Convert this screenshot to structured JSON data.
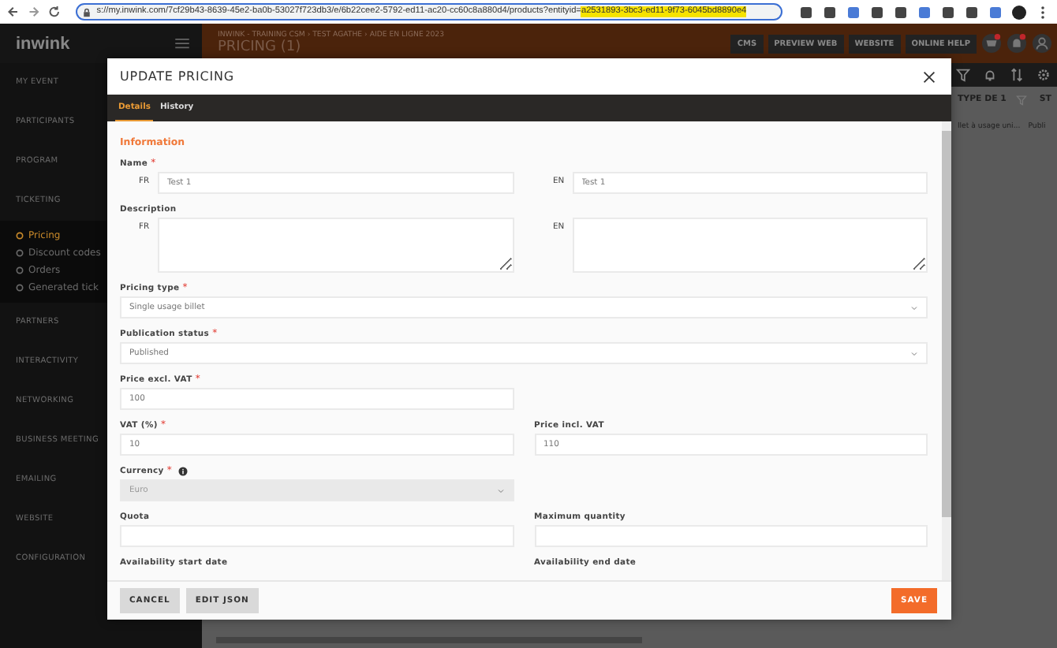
{
  "browser": {
    "url": "s://my.inwink.com/7cf29b43-8639-45e2-ba0b-53027f723db3/e/6b22cee2-5792-ed11-ac20-cc60c8a880d4/products?entityid=",
    "url_highlight": "a2531893-3bc3-ed11-9f73-6045bd8890e4"
  },
  "app": {
    "logo": "inwink",
    "breadcrumb": "INWINK - TRAINING CSM › TEST AGATHE › AIDE EN LIGNE 2023",
    "page_title": "PRICING (1)",
    "header_buttons": [
      "CMS",
      "PREVIEW WEB",
      "WEBSITE",
      "ONLINE HELP"
    ]
  },
  "sidebar": {
    "items": [
      {
        "label": "MY EVENT"
      },
      {
        "label": "PARTICIPANTS"
      },
      {
        "label": "PROGRAM"
      },
      {
        "label": "TICKETING",
        "children": [
          {
            "label": "Pricing",
            "selected": true
          },
          {
            "label": "Discount codes",
            "selected": false
          },
          {
            "label": "Orders",
            "selected": false
          },
          {
            "label": "Generated tick",
            "selected": false
          }
        ]
      },
      {
        "label": "PARTNERS"
      },
      {
        "label": "INTERACTIVITY"
      },
      {
        "label": "NETWORKING"
      },
      {
        "label": "BUSINESS MEETING"
      },
      {
        "label": "EMAILING"
      },
      {
        "label": "WEBSITE"
      },
      {
        "label": "CONFIGURATION"
      }
    ]
  },
  "table": {
    "columns": [
      "TYPE DE 1",
      "ST"
    ],
    "rows": [
      [
        "llet à usage uni...",
        "Publi"
      ]
    ]
  },
  "modal": {
    "title": "UPDATE PRICING",
    "tabs": [
      {
        "label": "Details",
        "selected": true
      },
      {
        "label": "History",
        "selected": false
      }
    ],
    "section_title": "Information",
    "rows": [
      {
        "fields": [
          {
            "label": "Name",
            "required_mark": "*",
            "kind": "translated",
            "langs": [
              {
                "code": "FR",
                "value": "Test 1"
              },
              {
                "code": "EN",
                "value": "Test 1"
              }
            ]
          }
        ]
      },
      {
        "fields": [
          {
            "label": "Description",
            "kind": "translated-area",
            "langs": [
              {
                "code": "FR"
              },
              {
                "code": "EN"
              }
            ]
          }
        ]
      },
      {
        "fields": [
          {
            "label": "Pricing type",
            "required_mark": "*",
            "kind": "select-wide",
            "disabled": false,
            "value": "Single usage billet"
          }
        ]
      },
      {
        "fields": [
          {
            "label": "Publication status",
            "required_mark": "*",
            "kind": "select-wide",
            "disabled": false,
            "value": "Published"
          }
        ]
      },
      {
        "fields": [
          {
            "label": "Price excl. VAT",
            "required_mark": "*",
            "kind": "input",
            "value": "100"
          }
        ]
      },
      {
        "fields": [
          {
            "label": "VAT (%)",
            "required_mark": "*",
            "kind": "input",
            "value": "10"
          },
          {
            "label": "Price incl. VAT",
            "kind": "input",
            "value": "110"
          }
        ]
      },
      {
        "fields": [
          {
            "label": "Currency",
            "required_mark": "*",
            "info": true,
            "kind": "select",
            "disabled": true,
            "value": "Euro"
          }
        ]
      },
      {
        "fields": [
          {
            "label": "Quota",
            "kind": "input"
          },
          {
            "label": "Maximum quantity",
            "kind": "input"
          }
        ]
      },
      {
        "fields": [
          {
            "label": "Availability start date",
            "kind": "label-only"
          },
          {
            "label": "Availability end date",
            "kind": "label-only"
          }
        ]
      }
    ],
    "buttons": [
      {
        "label": "CANCEL",
        "kind": "secondary"
      },
      {
        "label": "EDIT JSON",
        "kind": "secondary"
      },
      {
        "label": "SAVE",
        "kind": "primary"
      }
    ]
  }
}
